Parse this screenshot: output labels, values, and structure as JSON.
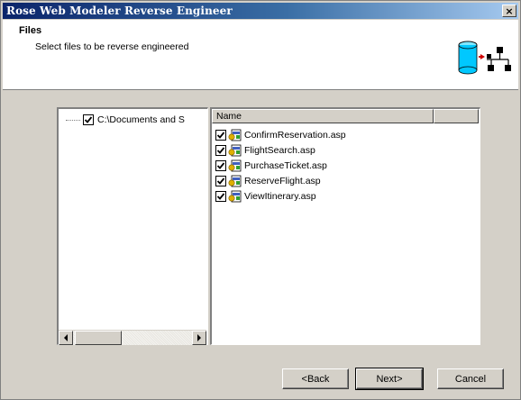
{
  "window": {
    "title": "Rose Web Modeler Reverse Engineer",
    "close_label": "×"
  },
  "header": {
    "title": "Files",
    "subtitle": "Select files to be reverse engineered"
  },
  "tree": {
    "items": [
      {
        "label": "C:\\Documents and S",
        "checked": true
      }
    ]
  },
  "list": {
    "columns": [
      "Name",
      ""
    ],
    "items": [
      {
        "label": "ConfirmReservation.asp",
        "checked": true
      },
      {
        "label": "FlightSearch.asp",
        "checked": true
      },
      {
        "label": "PurchaseTicket.asp",
        "checked": true
      },
      {
        "label": "ReserveFlight.asp",
        "checked": true
      },
      {
        "label": "ViewItinerary.asp",
        "checked": true
      }
    ]
  },
  "buttons": {
    "back": "<Back",
    "next": "Next>",
    "cancel": "Cancel"
  },
  "colors": {
    "title_start": "#0a246a",
    "title_end": "#a6caf0",
    "face": "#d4d0c8",
    "database": "#00c8ff"
  }
}
